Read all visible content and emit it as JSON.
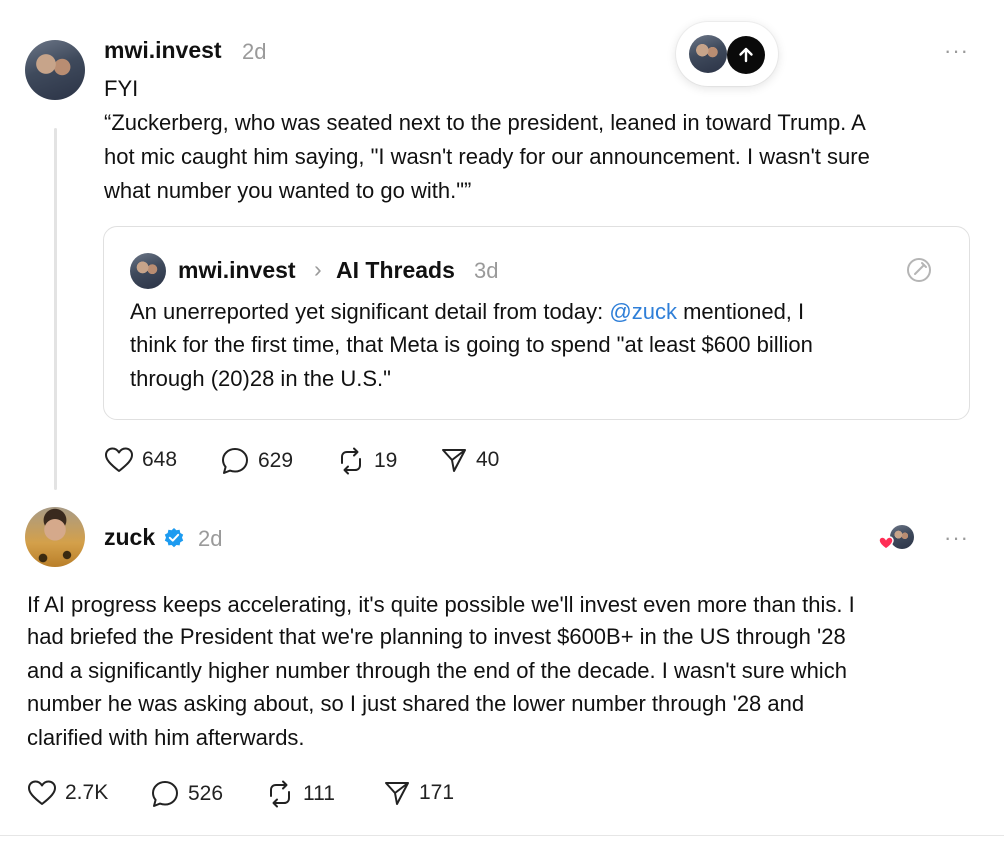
{
  "floating": {
    "scroll_top_label": "scroll to top"
  },
  "post1": {
    "username": "mwi.invest",
    "timestamp": "2d",
    "more": "···",
    "lines": [
      "FYI",
      "“Zuckerberg, who was seated next to the president, leaned in toward Trump. A",
      "hot mic caught him saying, \"I wasn't ready for our announcement. I wasn't sure",
      "what number you wanted to go with.\"”"
    ],
    "quote": {
      "username": "mwi.invest",
      "separator": "›",
      "topic": "AI Threads",
      "timestamp": "3d",
      "line1_before": "An unerreported yet significant detail from today: ",
      "line1_mention": "@zuck",
      "line1_after": " mentioned, I",
      "line2": "think for the first time, that Meta is going to spend \"at least $600 billion",
      "line3": "through (20)28 in the U.S.\""
    },
    "actions": {
      "likes": "648",
      "replies": "629",
      "reposts": "19",
      "shares": "40"
    }
  },
  "post2": {
    "username": "zuck",
    "timestamp": "2d",
    "more": "···",
    "lines": [
      "If AI progress keeps accelerating, it's quite possible we'll invest even more than this. I",
      "had briefed the President that we're planning to invest $600B+ in the US through '28",
      "and a significantly higher number through the end of the decade. I wasn't sure which",
      "number he was asking about, so I just shared the lower number through '28 and",
      "clarified with him afterwards."
    ],
    "actions": {
      "likes": "2.7K",
      "replies": "526",
      "reposts": "111",
      "shares": "171"
    }
  },
  "colors": {
    "link": "#2f7fd8",
    "verified": "#1d9bf0",
    "heart": "#ff2d55",
    "muted": "#9a9a9a"
  }
}
